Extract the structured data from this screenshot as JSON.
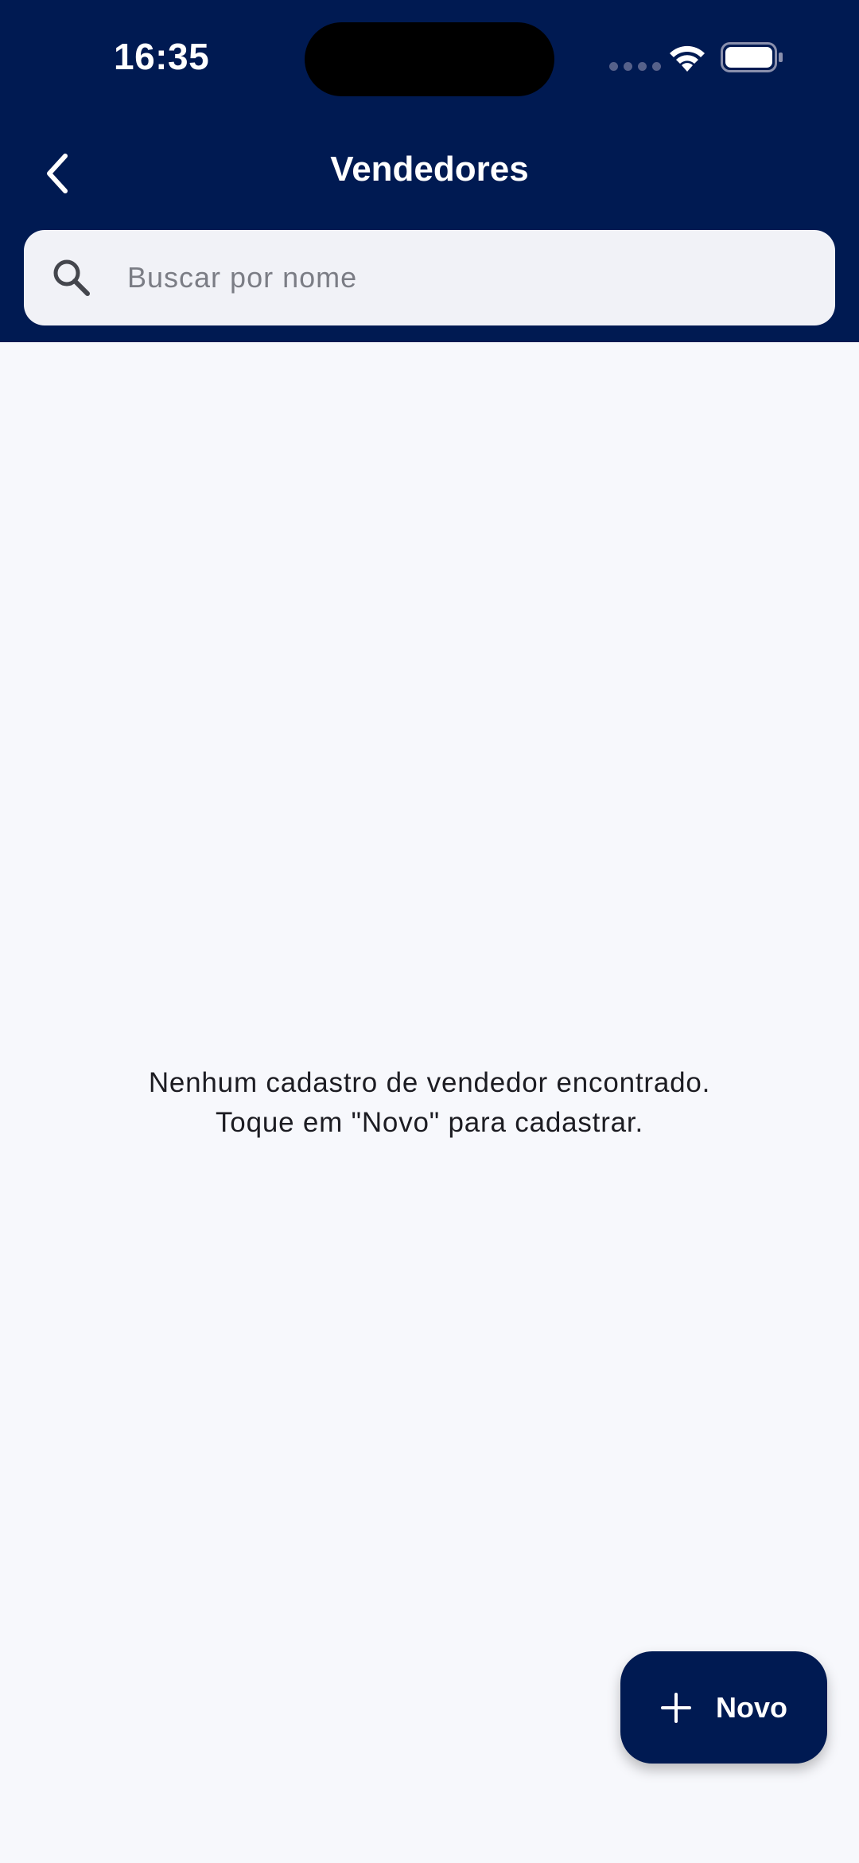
{
  "status_bar": {
    "time": "16:35"
  },
  "header": {
    "title": "Vendedores",
    "background_color": "#001a52"
  },
  "search": {
    "placeholder": "Buscar por nome",
    "value": ""
  },
  "empty_state": {
    "line1": "Nenhum cadastro de vendedor encontrado.",
    "line2": "Toque em \"Novo\" para cadastrar."
  },
  "fab": {
    "label": "Novo",
    "icon": "plus-icon"
  },
  "icons": {
    "back": "chevron-left-icon",
    "search": "search-icon",
    "wifi": "wifi-icon",
    "battery": "battery-icon"
  },
  "colors": {
    "primary": "#001a52",
    "background": "#f7f8fc",
    "search_field": "#f1f2f7"
  }
}
